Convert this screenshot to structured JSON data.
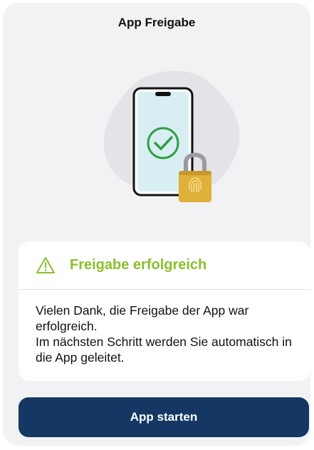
{
  "header": {
    "title": "App Freigabe"
  },
  "illustration": {
    "icons": [
      "smartphone-icon",
      "check-circle-icon",
      "padlock-icon",
      "fingerprint-icon"
    ],
    "check_color": "#2ea043",
    "lock_color": "#e0b13a"
  },
  "status_card": {
    "icon": "warning-triangle-icon",
    "title": "Freigabe erfolgreich",
    "title_color": "#8bbf2c",
    "message_line1": "Vielen Dank, die Freigabe der App war erfolgreich.",
    "message_line2": "Im nächsten Schritt werden Sie automatisch in die App geleitet."
  },
  "actions": {
    "start_label": "App starten",
    "button_color": "#143763"
  }
}
